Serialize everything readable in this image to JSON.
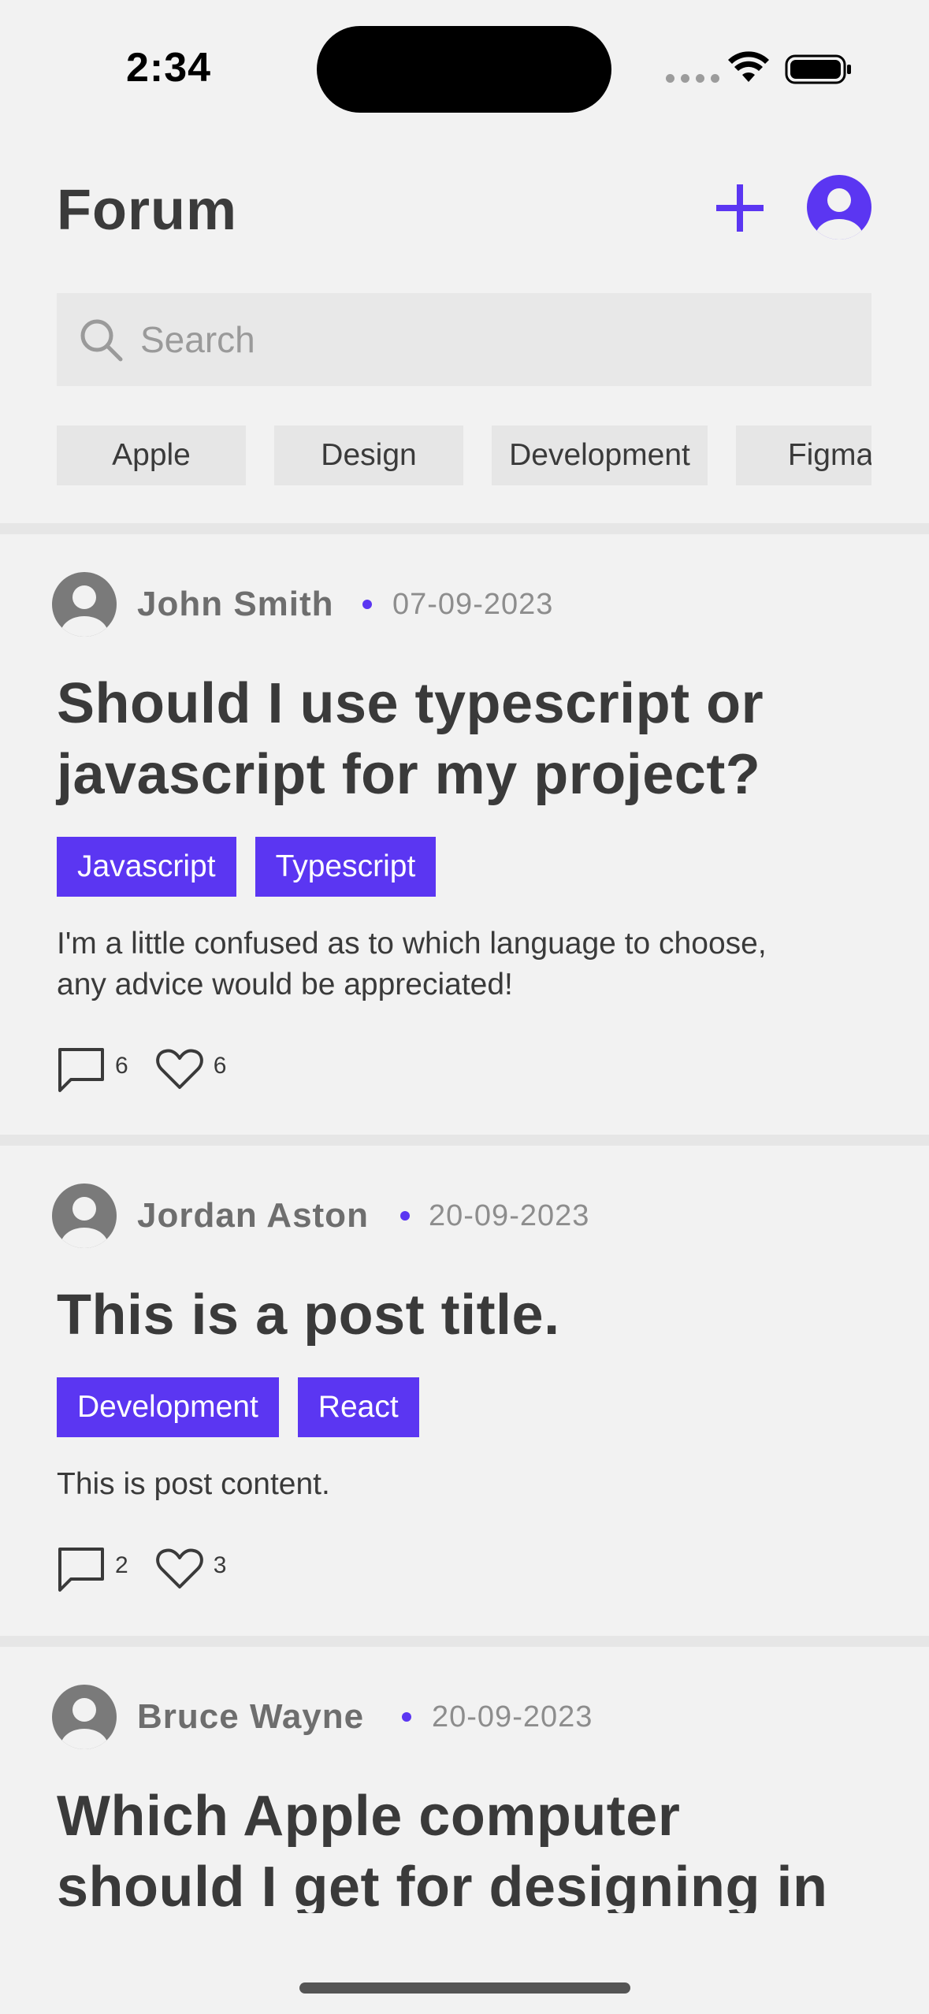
{
  "status_bar": {
    "time": "2:34"
  },
  "header": {
    "title": "Forum",
    "add_icon": "plus-icon",
    "profile_icon": "user-circle-icon"
  },
  "search": {
    "placeholder": "Search",
    "value": ""
  },
  "categories": [
    "Apple",
    "Design",
    "Development",
    "Figma"
  ],
  "posts": [
    {
      "author": "John Smith",
      "date": "07-09-2023",
      "title_lines": [
        "Should I use typescript or",
        "javascript for my project?"
      ],
      "tags": [
        "Javascript",
        "Typescript"
      ],
      "body_lines": [
        "I'm a little confused as to which language to choose,",
        "any advice would be appreciated!"
      ],
      "comments": "6",
      "likes": "6"
    },
    {
      "author": "Jordan Aston",
      "date": "20-09-2023",
      "title_lines": [
        "This is a post title."
      ],
      "tags": [
        "Development",
        "React"
      ],
      "body_lines": [
        "This is post content."
      ],
      "comments": "2",
      "likes": "3"
    },
    {
      "author": "Bruce Wayne",
      "date": "20-09-2023",
      "title_lines": [
        "Which Apple computer",
        "should I get for designing in"
      ]
    }
  ],
  "colors": {
    "accent": "#5b36f2",
    "background": "#f2f2f2",
    "chip": "#e6e6e6",
    "text": "#3a3a3a"
  }
}
